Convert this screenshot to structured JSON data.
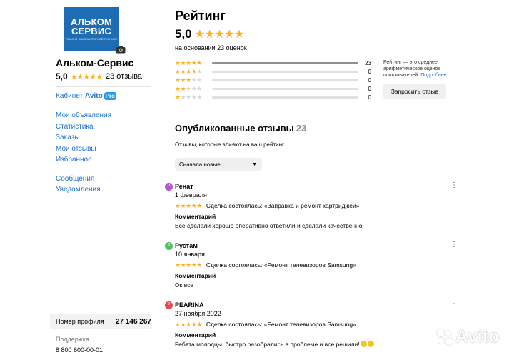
{
  "seller": {
    "logo_line1": "АЛЬКОМ",
    "logo_line2": "СЕРВИС",
    "logo_line3": "РЕМОНТ КОМПЬЮТЕРНОЙ ТЕХНИКИ",
    "name": "Альком-Сервис",
    "rating": "5,0",
    "stars": "★★★★★",
    "reviews_count": "23 отзыва"
  },
  "cabinet": {
    "label": "Кабинет",
    "avito": "Avito",
    "pro": "Pro"
  },
  "nav": {
    "items": [
      "Мои объявления",
      "Статистика",
      "Заказы",
      "Мои отзывы",
      "Избранное",
      "Сообщения",
      "Уведомления"
    ]
  },
  "profile": {
    "label": "Номер профиля",
    "number": "27 146 267"
  },
  "support": {
    "label": "Поддержка",
    "phone": "8 800 600-00-01"
  },
  "rating_section": {
    "title": "Рейтинг",
    "value": "5,0",
    "stars": "★★★★★",
    "based_on": "на основании 23 оценок",
    "distribution": [
      {
        "stars_on": "★★★★★",
        "stars_off": "",
        "count": "23",
        "fraction": 1.0
      },
      {
        "stars_on": "★★★★",
        "stars_off": "★",
        "count": "0",
        "fraction": 0
      },
      {
        "stars_on": "★★★",
        "stars_off": "★★",
        "count": "0",
        "fraction": 0
      },
      {
        "stars_on": "★★",
        "stars_off": "★★★",
        "count": "0",
        "fraction": 0
      },
      {
        "stars_on": "★",
        "stars_off": "★★★★",
        "count": "0",
        "fraction": 0
      }
    ],
    "info_text": "Рейтинг — это среднее арифметическое оценок пользователей.",
    "info_link": "Подробнее",
    "request_button": "Запросить отзыв"
  },
  "published": {
    "title": "Опубликованные отзывы",
    "count": "23",
    "subtitle": "Отзывы, которые влияют на ваш рейтинг.",
    "sort": "Сначала новые"
  },
  "reviews": [
    {
      "initial": "Р",
      "avatar_color": "#b455d6",
      "name": "Ренат",
      "date": "1 февраля",
      "stars": "★★★★★",
      "deal": "Сделка состоялась: «Заправка и ремонт картриджей»",
      "comment_title": "Комментарий",
      "comment": "Всё сделали хорошо оперативно ответили и сделали качественно"
    },
    {
      "initial": "Р",
      "avatar_color": "#4fbf6a",
      "name": "Рустам",
      "date": "10 января",
      "stars": "★★★★★",
      "deal": "Сделка состоялась: «Ремонт телевизоров Samsung»",
      "comment_title": "Комментарий",
      "comment": "Ок все"
    },
    {
      "initial": "P",
      "avatar_color": "#e5484d",
      "name": "PEARINA",
      "date": "27 ноября 2022",
      "stars": "★★★★★",
      "deal": "Сделка состоялась: «Ремонт телевизоров Samsung»",
      "comment_title": "Комментарий",
      "comment": "Ребята молодцы, быстро разобрались в проблеме и все решили!"
    }
  ],
  "watermark": "Avito"
}
